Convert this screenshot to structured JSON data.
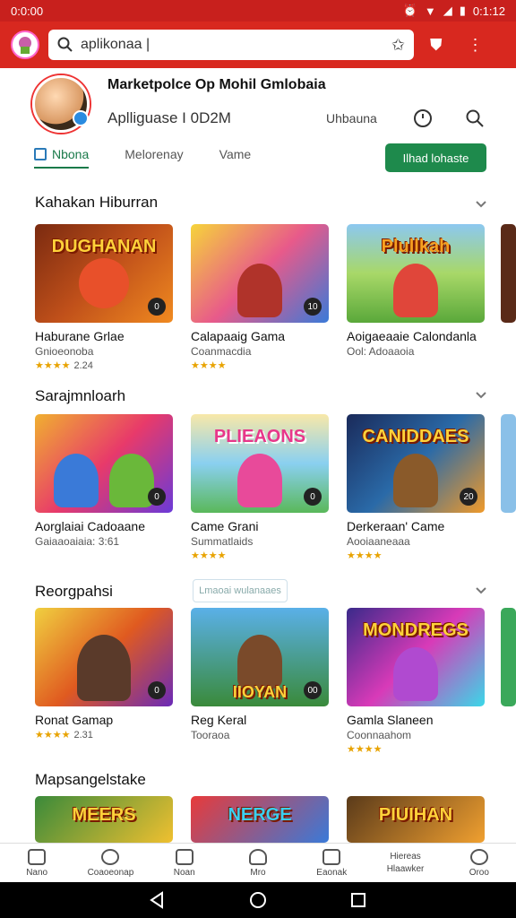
{
  "status": {
    "time": "0:0:00",
    "right": "0:1:12"
  },
  "search": {
    "query": "aplikonaa |"
  },
  "profile": {
    "title": "Marketpolce Op Mohil Gmlobaia",
    "subtitle": "Aplliguase I 0D2M",
    "meta": "Uhbauna",
    "tabs": [
      "Nbona",
      "Melorenay",
      "Vame"
    ],
    "install_label": "Ilhad lohaste"
  },
  "sections": [
    {
      "title": "Kahakan Hiburran",
      "cards": [
        {
          "title_art": "DUGHANAN",
          "name": "Haburane Grlae",
          "sub": "Gnioeonoba",
          "rating": "2.24"
        },
        {
          "title_art": "",
          "name": "Calapaaig Gama",
          "sub": "Coanmacdia",
          "rating": ""
        },
        {
          "title_art": "Plullkah",
          "name": "Aoigaeaaie Calondanla",
          "sub": "Ool: Adoaaoia",
          "rating": ""
        }
      ]
    },
    {
      "title": "Sarajmnloarh",
      "cards": [
        {
          "title_art": "",
          "name": "Aorglaiai Cadoaane",
          "sub": "Gaiaaoaiaia: 3:61",
          "rating": ""
        },
        {
          "title_art": "PLIEAONS",
          "name": "Came Grani",
          "sub": "Summatlaids",
          "rating": ""
        },
        {
          "title_art": "CANIDDAES",
          "name": "Derkeraan' Came",
          "sub": "Aooiaaneaaa",
          "rating": ""
        }
      ]
    },
    {
      "title": "Reorgpahsi",
      "filter_chip": "Lmaoai wulanaaes",
      "cards": [
        {
          "title_art": "",
          "name": "Ronat Gamap",
          "sub": "",
          "rating": "2.31"
        },
        {
          "title_art": "IIOYAN",
          "name": "Reg Keral",
          "sub": "Tooraoa",
          "rating": ""
        },
        {
          "title_art": "MONDREGS",
          "name": "Gamla Slaneen",
          "sub": "Coonnaahom",
          "rating": ""
        }
      ]
    },
    {
      "title": "Mapsangelstake",
      "cards": [
        {
          "title_art": "MEERS",
          "name": "",
          "sub": "",
          "rating": ""
        },
        {
          "title_art": "NERGE",
          "name": "",
          "sub": "",
          "rating": ""
        },
        {
          "title_art": "PIUIHAN",
          "name": "",
          "sub": "",
          "rating": ""
        }
      ]
    }
  ],
  "bottom_nav": [
    "Nano",
    "Coaoeonap",
    "Noan",
    "Mro",
    "Eaonak",
    "Hlaawker",
    "Oroo"
  ],
  "bottom_nav_extra": "Hiereas",
  "colors": {
    "brand": "#d8281f",
    "accent": "#1e8a4c"
  }
}
